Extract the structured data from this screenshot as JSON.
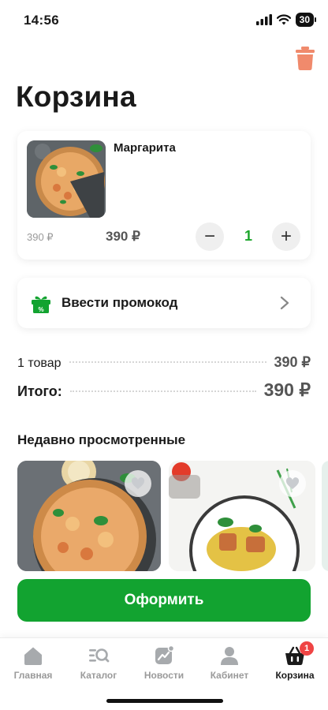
{
  "status": {
    "time": "14:56",
    "battery": "30"
  },
  "page": {
    "title": "Корзина"
  },
  "cart": {
    "items": [
      {
        "name": "Маргарита",
        "old_price": "390 ₽",
        "price": "390 ₽",
        "quantity": "1"
      }
    ],
    "minus_label": "−",
    "plus_label": "+"
  },
  "promo": {
    "label": "Ввести промокод"
  },
  "summary": {
    "items_label": "1 товар",
    "items_value": "390 ₽",
    "total_label": "Итого:",
    "total_value": "390 ₽"
  },
  "recent": {
    "title": "Недавно просмотренные"
  },
  "checkout": {
    "label": "Оформить"
  },
  "tabbar": {
    "tabs": [
      {
        "label": "Главная",
        "icon": "home-icon"
      },
      {
        "label": "Каталог",
        "icon": "catalog-search-icon"
      },
      {
        "label": "Новости",
        "icon": "news-chart-icon"
      },
      {
        "label": "Кабинет",
        "icon": "user-icon"
      },
      {
        "label": "Корзина",
        "icon": "basket-icon",
        "active": true,
        "badge": "1"
      }
    ]
  },
  "colors": {
    "accent": "#12a330",
    "quantity": "#1aa52a",
    "trash": "#f08a6c",
    "badge": "#ef4444"
  }
}
